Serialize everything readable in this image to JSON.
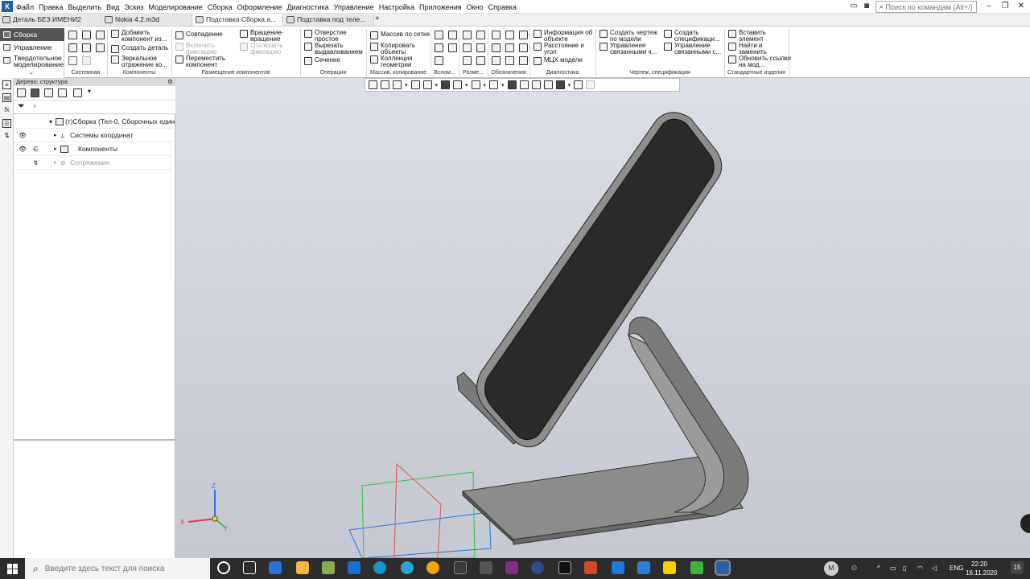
{
  "app": {
    "logo": "К",
    "menu": [
      "Файл",
      "Правка",
      "Выделить",
      "Вид",
      "Эскиз",
      "Моделирование",
      "Сборка",
      "Оформление",
      "Диагностика",
      "Управление",
      "Настройка",
      "Приложения",
      "Окно",
      "Справка"
    ],
    "search_placeholder": "Поиск по командам (Alt+/)"
  },
  "tabs": [
    {
      "label": "Деталь БЕЗ ИМЕНИ2"
    },
    {
      "label": "Nokia 4.2.m3d"
    },
    {
      "label": "Подставка Сборка.a..."
    },
    {
      "label": "Подставка под теле..."
    }
  ],
  "ribbon_left": [
    {
      "label": "Сборка"
    },
    {
      "label": "Управление"
    },
    {
      "label": "Твердотельное моделирование"
    }
  ],
  "ribbon": {
    "groups": [
      "Системная",
      "Компоненты",
      "Размещение компонентов",
      "Операции",
      "Массив, копирование",
      "Вспом...",
      "Разме...",
      "Обозначения",
      "Диагностика",
      "Чертеж, спецификация",
      "Стандартные изделия"
    ],
    "komponenty": [
      "Добавить компонент из...",
      "Создать деталь",
      "Зеркальное отражение ко..."
    ],
    "razmeshchenie": [
      "Совпадение",
      "Включить фиксацию",
      "Переместить компонент",
      "Вращение-вращение",
      "Отключить фиксацию"
    ],
    "operacii": [
      "Отверстие простое",
      "Вырезать выдавливанием",
      "Сечение"
    ],
    "massiv": [
      "Массив по сетке",
      "Копировать объекты",
      "Коллекция геометрии"
    ],
    "diagnostika": [
      "Информация об объекте",
      "Расстояние и угол",
      "МЦХ модели"
    ],
    "chertezh": [
      "Создать чертеж по модели",
      "Управление связанными ч...",
      "Создать спецификаци...",
      "Управление связанными с..."
    ],
    "standart": [
      "Вставить элемент",
      "Найти и заменить",
      "Обновить ссылки на мод..."
    ]
  },
  "tree": {
    "header": "Дерево: структура",
    "rows": [
      {
        "label": "(т)Сборка (Тел-0, Сборочных един"
      },
      {
        "label": "Системы координат"
      },
      {
        "label": "Компоненты"
      },
      {
        "label": "Сопряжения"
      }
    ]
  },
  "viewport": {
    "axes": {
      "x": "X",
      "y": "Y",
      "z": "Z"
    }
  },
  "taskbar": {
    "search_placeholder": "Введите здесь текст для поиска",
    "lang": "ENG",
    "time": "22:20",
    "date": "16.11.2020",
    "avatar": "M",
    "notifications": "15"
  }
}
